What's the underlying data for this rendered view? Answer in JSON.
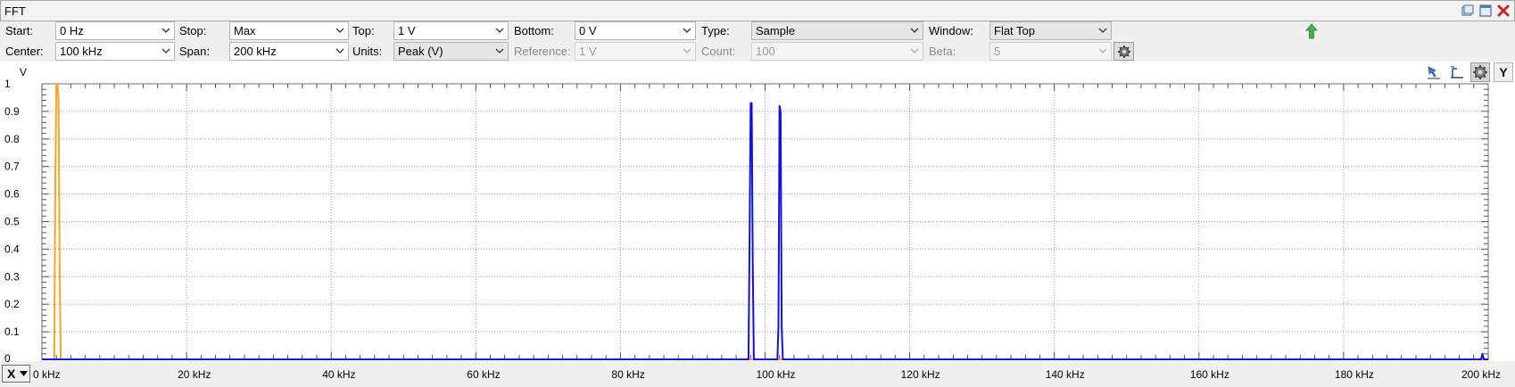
{
  "window": {
    "title": "FFT",
    "buttons": [
      "restore-icon",
      "maximize-icon",
      "close-icon"
    ]
  },
  "toolbar": {
    "start_label": "Start:",
    "start_value": "0 Hz",
    "stop_label": "Stop:",
    "stop_value": "Max",
    "top_label": "Top:",
    "top_value": "1 V",
    "bottom_label": "Bottom:",
    "bottom_value": "0 V",
    "type_label": "Type:",
    "type_value": "Sample",
    "window_label": "Window:",
    "window_value": "Flat Top",
    "center_label": "Center:",
    "center_value": "100 kHz",
    "span_label": "Span:",
    "span_value": "200 kHz",
    "units_label": "Units:",
    "units_value": "Peak (V)",
    "reference_label": "Reference:",
    "reference_value": "1 V",
    "count_label": "Count:",
    "count_value": "100",
    "beta_label": "Beta:",
    "beta_value": "5"
  },
  "plot_tools": {
    "y_button_label": "Y",
    "x_button_label": "X"
  },
  "colors": {
    "series_orange": "#f5a623",
    "series_blue": "#1010e0",
    "grid": "#9a9a9a",
    "up_arrow": "#4caf50"
  },
  "chart_data": {
    "type": "line",
    "ylabel": "V",
    "xlim": [
      0,
      200
    ],
    "ylim": [
      0,
      1
    ],
    "x_unit": "kHz",
    "x_ticks": [
      0,
      20,
      40,
      60,
      80,
      100,
      120,
      140,
      160,
      180,
      200
    ],
    "x_tick_labels": [
      "0 kHz",
      "20 kHz",
      "40 kHz",
      "60 kHz",
      "80 kHz",
      "100 kHz",
      "120 kHz",
      "140 kHz",
      "160 kHz",
      "180 kHz",
      "200 kHz"
    ],
    "y_ticks": [
      0,
      0.1,
      0.2,
      0.3,
      0.4,
      0.5,
      0.6,
      0.7,
      0.8,
      0.9,
      1
    ],
    "y_tick_labels": [
      "0",
      "0.1",
      "0.2",
      "0.3",
      "0.4",
      "0.5",
      "0.6",
      "0.7",
      "0.8",
      "0.9",
      "1"
    ],
    "grid": true,
    "series": [
      {
        "color": "#f5a623",
        "x": [
          0,
          1.7,
          1.85,
          2.0,
          2.15,
          2.3,
          2.45,
          2.6,
          200
        ],
        "y": [
          0,
          0,
          0.65,
          1.0,
          1.0,
          0.95,
          0.3,
          0,
          0
        ]
      },
      {
        "color": "#1010e0",
        "x": [
          0,
          97.7,
          97.85,
          98.0,
          98.15,
          98.3,
          98.45,
          98.6,
          101.7,
          101.85,
          102.0,
          102.15,
          102.3,
          102.45,
          102.6,
          199.0,
          199.2,
          199.4,
          200
        ],
        "y": [
          0,
          0,
          0.42,
          0.93,
          0.93,
          0.34,
          0,
          0,
          0,
          0.12,
          0.92,
          0.9,
          0.12,
          0,
          0,
          0,
          0.02,
          0,
          0
        ]
      }
    ]
  }
}
